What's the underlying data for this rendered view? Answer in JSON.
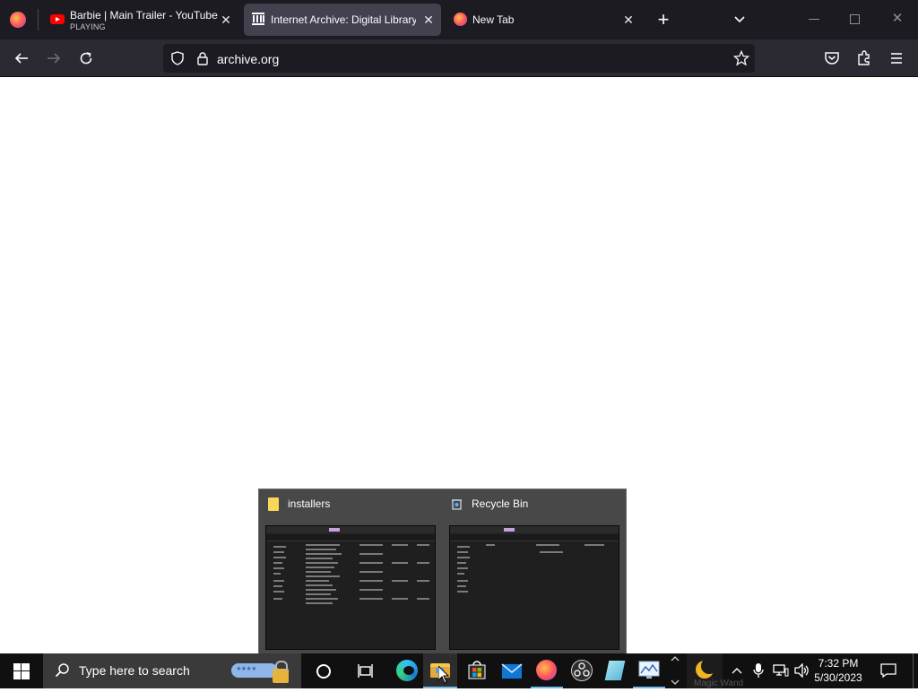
{
  "browser": {
    "tabs": [
      {
        "title": "Barbie | Main Trailer - YouTube",
        "subtitle": "PLAYING",
        "icon": "youtube-icon"
      },
      {
        "title": "Internet Archive: Digital Library",
        "icon": "archive-icon",
        "active": true
      },
      {
        "title": "New Tab",
        "icon": "firefox-icon"
      }
    ],
    "url": "archive.org"
  },
  "taskbar": {
    "search_placeholder": "Type here to search",
    "clock_time": "7:32 PM",
    "clock_date": "5/30/2023",
    "tray_label": "Magic Wand"
  },
  "thumbnails": [
    {
      "title": "installers",
      "icon": "folder-icon"
    },
    {
      "title": "Recycle Bin",
      "icon": "recycle-bin-icon"
    }
  ],
  "colors": {
    "tab_bg": "#1c1b22",
    "nav_bg": "#2b2a33",
    "taskbar_bg": "#101010",
    "accent_blue": "#0078d4"
  }
}
